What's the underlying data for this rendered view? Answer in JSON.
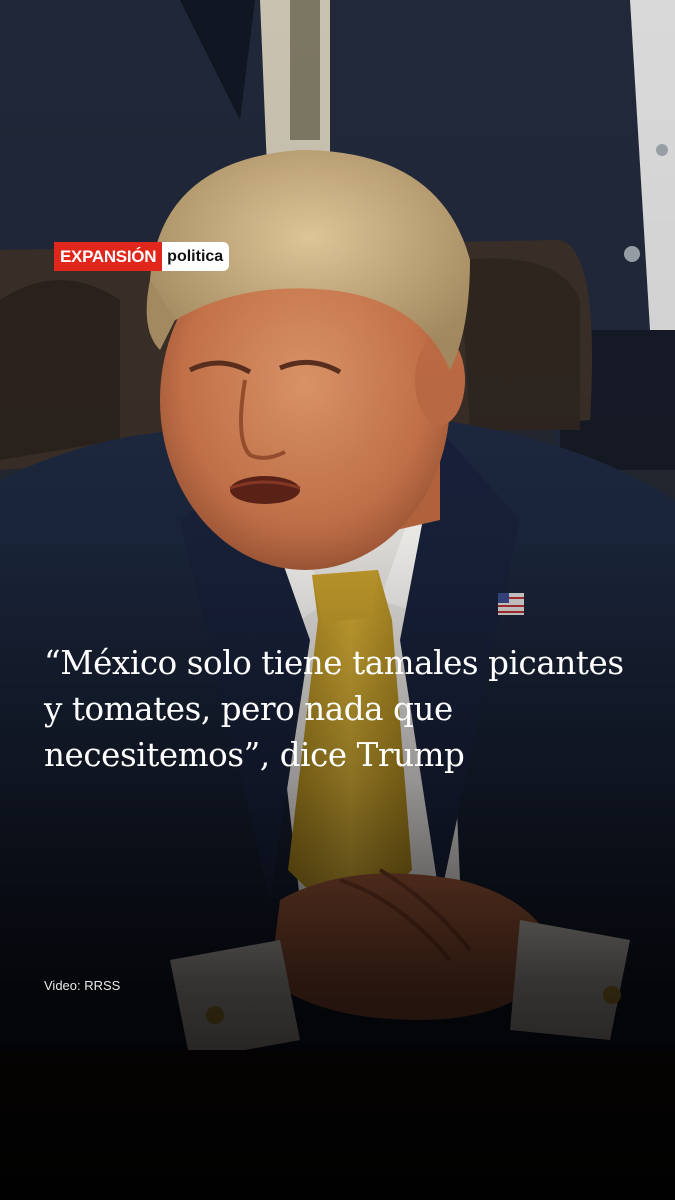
{
  "logo": {
    "brand": "EXPANSIÓN",
    "section": "politica",
    "brand_color": "#e1261c"
  },
  "headline": "“México solo tiene tamales picantes y tomates, pero nada que necesitemos”, dice Trump",
  "credit": "Video: RRSS",
  "colors": {
    "text": "#ffffff",
    "background": "#0d1018",
    "tie": "#c9a227",
    "suit": "#1a2438"
  }
}
